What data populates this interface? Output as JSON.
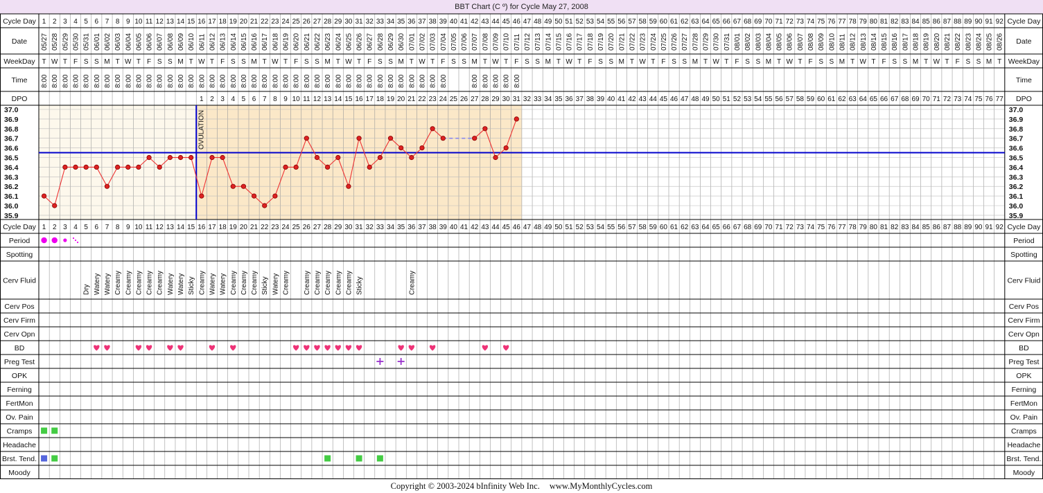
{
  "title": "BBT Chart (C º) for Cycle May 27, 2008",
  "copyright": "Copyright © 2003-2024 bInfinity Web Inc.",
  "site": "www.MyMonthlyCycles.com",
  "row_labels": {
    "cycle_day": "Cycle Day",
    "date": "Date",
    "weekday": "WeekDay",
    "time": "Time",
    "dpo": "DPO",
    "period": "Period",
    "spotting": "Spotting",
    "cerv_fluid": "Cerv Fluid",
    "cerv_pos": "Cerv Pos",
    "cerv_firm": "Cerv Firm",
    "cerv_opn": "Cerv Opn",
    "bd": "BD",
    "preg_test": "Preg Test",
    "opk": "OPK",
    "ferning": "Ferning",
    "fertmon": "FertMon",
    "ov_pain": "Ov. Pain",
    "cramps": "Cramps",
    "headache": "Headache",
    "brst_tend": "Brst. Tend.",
    "moody": "Moody"
  },
  "ovulation_label": "OVULATION",
  "colors": {
    "title_bg": "#f0e0f4",
    "pre_ov": "#fdf8ec",
    "post_ov": "#fbe8c8",
    "coverline": "#0000cc",
    "temp_line": "#ee3333",
    "marker": "#dd2222",
    "period": "#ee00ee",
    "bd": "#ee3377",
    "preg": "#9933cc",
    "green": "#44cc44",
    "blue": "#5566dd"
  },
  "dates": [
    "05/27",
    "05/28",
    "05/29",
    "05/30",
    "05/31",
    "06/01",
    "06/02",
    "06/03",
    "06/04",
    "06/05",
    "06/06",
    "06/07",
    "06/08",
    "06/09",
    "06/10",
    "06/11",
    "06/12",
    "06/13",
    "06/14",
    "06/15",
    "06/16",
    "06/17",
    "06/18",
    "06/19",
    "06/20",
    "06/21",
    "06/22",
    "06/23",
    "06/24",
    "06/25",
    "06/26",
    "06/27",
    "06/28",
    "06/29",
    "06/30",
    "07/01",
    "07/02",
    "07/03",
    "07/04",
    "07/05",
    "07/06",
    "07/07",
    "07/08",
    "07/09",
    "07/10",
    "07/11",
    "07/12",
    "07/13",
    "07/14",
    "07/15",
    "07/16",
    "07/17",
    "07/18",
    "07/19",
    "07/20",
    "07/21",
    "07/22",
    "07/23",
    "07/24",
    "07/25",
    "07/26",
    "07/27",
    "07/28",
    "07/29",
    "07/30",
    "07/31",
    "08/01",
    "08/02",
    "08/03",
    "08/04",
    "08/05",
    "08/06",
    "08/07",
    "08/08",
    "08/09",
    "08/10",
    "08/11",
    "08/12",
    "08/13",
    "08/14",
    "08/15",
    "08/16",
    "08/17",
    "08/18",
    "08/19",
    "08/20",
    "08/21",
    "08/22",
    "08/23",
    "08/24",
    "08/25",
    "08/26"
  ],
  "weekdays": [
    "T",
    "W",
    "T",
    "F",
    "S",
    "S",
    "M",
    "T",
    "W",
    "T",
    "F",
    "S",
    "S",
    "M",
    "T",
    "W",
    "T",
    "F",
    "S",
    "S",
    "M",
    "T",
    "W",
    "T",
    "F",
    "S",
    "S",
    "M",
    "T",
    "W",
    "T",
    "F",
    "S",
    "S",
    "M",
    "T",
    "W",
    "T",
    "F",
    "S",
    "S",
    "M",
    "T",
    "W",
    "T",
    "F",
    "S",
    "S",
    "M",
    "T",
    "W",
    "T",
    "F",
    "S",
    "S",
    "M",
    "T",
    "W",
    "T",
    "F",
    "S",
    "S",
    "M",
    "T",
    "W",
    "T",
    "F",
    "S",
    "S",
    "M",
    "T",
    "W",
    "T",
    "F",
    "S",
    "S",
    "M",
    "T",
    "W",
    "T",
    "F",
    "S",
    "S",
    "M",
    "T",
    "W",
    "T",
    "F",
    "S",
    "S",
    "M",
    "T"
  ],
  "times": [
    "8:00",
    "8:00",
    "8:00",
    "8:00",
    "8:00",
    "8:00",
    "8:00",
    "8:00",
    "8:00",
    "8:00",
    "8:00",
    "8:00",
    "8:00",
    "8:00",
    "8:00",
    "8:00",
    "8:00",
    "8:00",
    "8:00",
    "8:00",
    "8:00",
    "8:00",
    "8:00",
    "8:00",
    "8:00",
    "8:00",
    "8:00",
    "8:00",
    "8:00",
    "8:00",
    "8:00",
    "8:00",
    "8:00",
    "8:00",
    "8:00",
    "8:00",
    "8:00",
    "8:00",
    "8:00",
    "",
    "",
    "8:00",
    "8:00",
    "8:00",
    "8:00",
    "8:00"
  ],
  "cerv_fluid": [
    "",
    "",
    "",
    "",
    "Dry",
    "Watery",
    "Watery",
    "Creamy",
    "Creamy",
    "Creamy",
    "Creamy",
    "Creamy",
    "Watery",
    "Watery",
    "Sticky",
    "Creamy",
    "Watery",
    "Watery",
    "Creamy",
    "Creamy",
    "Creamy",
    "Sticky",
    "Watery",
    "Creamy",
    "",
    "Creamy",
    "Creamy",
    "Creamy",
    "Creamy",
    "Creamy",
    "Sticky",
    "",
    "",
    "",
    "",
    "Creamy"
  ],
  "period": {
    "days": [
      1,
      2,
      3,
      4
    ],
    "sizes": [
      "heavy",
      "heavy",
      "medium",
      "spotting"
    ]
  },
  "bd_days": [
    6,
    7,
    10,
    11,
    13,
    14,
    17,
    19,
    25,
    26,
    27,
    28,
    29,
    30,
    31,
    35,
    36,
    38,
    43,
    45
  ],
  "preg_test_days": [
    33,
    35
  ],
  "cramps_days": [
    1,
    2
  ],
  "brst_tend": [
    {
      "day": 1,
      "color": "blue"
    },
    {
      "day": 2,
      "color": "green"
    },
    {
      "day": 28,
      "color": "green"
    },
    {
      "day": 31,
      "color": "green"
    },
    {
      "day": 33,
      "color": "green"
    }
  ],
  "chart_data": {
    "type": "line",
    "title": "BBT Chart (C º) for Cycle May 27, 2008",
    "x": [
      1,
      2,
      3,
      4,
      5,
      6,
      7,
      8,
      9,
      10,
      11,
      12,
      13,
      14,
      15,
      16,
      17,
      18,
      19,
      20,
      21,
      22,
      23,
      24,
      25,
      26,
      27,
      28,
      29,
      30,
      31,
      32,
      33,
      34,
      35,
      36,
      37,
      38,
      39,
      42,
      43,
      44,
      45,
      46
    ],
    "y": [
      36.1,
      36.0,
      36.4,
      36.4,
      36.4,
      36.4,
      36.2,
      36.4,
      36.4,
      36.4,
      36.5,
      36.4,
      36.5,
      36.5,
      36.5,
      36.1,
      36.5,
      36.5,
      36.2,
      36.2,
      36.1,
      36.0,
      36.1,
      36.4,
      36.4,
      36.7,
      36.5,
      36.4,
      36.5,
      36.2,
      36.7,
      36.4,
      36.5,
      36.7,
      36.6,
      36.5,
      36.6,
      36.8,
      36.7,
      36.7,
      36.8,
      36.5,
      36.6,
      36.9
    ],
    "dashed_gap": [
      39,
      42
    ],
    "y_ticks": [
      "37.0",
      "36.9",
      "36.8",
      "36.7",
      "36.6",
      "36.5",
      "36.4",
      "36.3",
      "36.2",
      "36.1",
      "36.0",
      "35.9"
    ],
    "ylim": [
      35.9,
      37.0
    ],
    "coverline": 36.55,
    "ovulation_day": 15,
    "total_days": 92,
    "dpo_max": 77
  }
}
